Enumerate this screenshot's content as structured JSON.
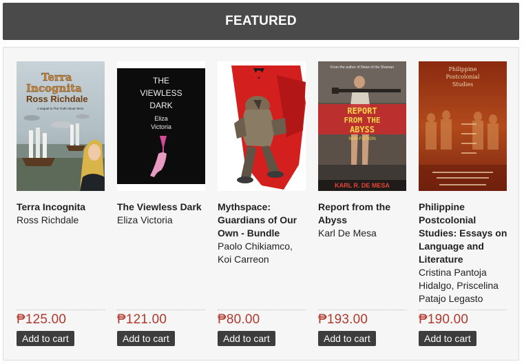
{
  "header": {
    "title": "FEATURED"
  },
  "products": [
    {
      "title": "Terra Incognita",
      "author": "Ross Richdale",
      "price": "₱125.00",
      "cta": "Add to cart",
      "cover": {
        "line1": "Terra",
        "line2": "Incognita",
        "author": "Ross Richdale",
        "tagline": "A sequel to The Truth About Terra"
      }
    },
    {
      "title": "The Viewless Dark",
      "author": "Eliza Victoria",
      "price": "₱121.00",
      "cta": "Add to cart",
      "cover": {
        "line1": "THE",
        "line2": "VIEWLESS",
        "line3": "DARK",
        "author_l1": "Eliza",
        "author_l2": "Victoria"
      }
    },
    {
      "title": "Mythspace: Guardians of Our Own - Bundle",
      "author": "Paolo Chikiamco, Koi Carreon",
      "price": "₱80.00",
      "cta": "Add to cart",
      "cover": {}
    },
    {
      "title": "Report from the Abyss",
      "author": "Karl De Mesa",
      "price": "₱193.00",
      "cta": "Add to cart",
      "cover": {
        "topline": "From the author of News of the Shaman",
        "t1": "REPORT",
        "t2": "FROM THE",
        "t3": "ABYSS",
        "sub": "NON-FICTION",
        "author": "KARL R. DE MESA"
      }
    },
    {
      "title": "Philippine Postcolonial Studies: Essays on Language and Literature",
      "author": "Cristina Pantoja Hidalgo, Priscelina Patajo Legasto",
      "price": "₱190.00",
      "cta": "Add to cart",
      "cover": {
        "t1": "Philippine",
        "t2": "Postcolonial",
        "t3": "Studies"
      }
    }
  ],
  "colors": {
    "header_bg": "#4a4a4a",
    "price": "#b0382c",
    "button_bg": "#3d3d3d",
    "panel_bg": "#f6f6f6"
  }
}
